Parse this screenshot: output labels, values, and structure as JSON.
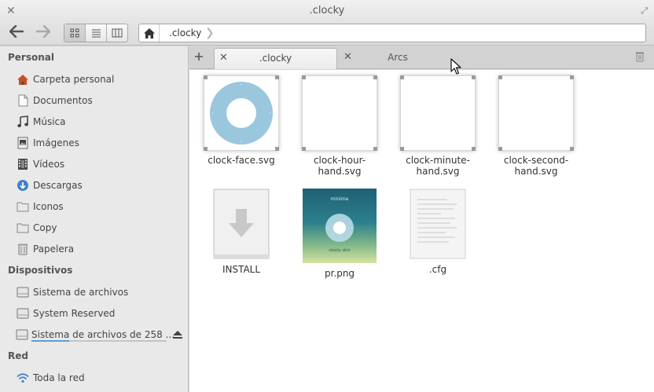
{
  "window": {
    "title": ".clocky"
  },
  "pathbar": {
    "crumb": ".clocky"
  },
  "sidebar": {
    "personal_title": "Personal",
    "personal": [
      {
        "label": "Carpeta personal",
        "icon": "home-icon"
      },
      {
        "label": "Documentos",
        "icon": "document-icon"
      },
      {
        "label": "Música",
        "icon": "music-icon"
      },
      {
        "label": "Imágenes",
        "icon": "image-icon"
      },
      {
        "label": "Vídeos",
        "icon": "video-icon"
      },
      {
        "label": "Descargas",
        "icon": "download-icon"
      },
      {
        "label": "Iconos",
        "icon": "folder-icon"
      },
      {
        "label": "Copy",
        "icon": "folder-icon"
      },
      {
        "label": "Papelera",
        "icon": "trash-icon"
      }
    ],
    "devices_title": "Dispositivos",
    "devices": [
      {
        "label": "Sistema de archivos",
        "icon": "drive-icon"
      },
      {
        "label": "System Reserved",
        "icon": "drive-icon"
      },
      {
        "label": "Sistema de archivos de 258 ...",
        "icon": "drive-icon",
        "usage_percent": 28
      }
    ],
    "network_title": "Red",
    "network": [
      {
        "label": "Toda la red",
        "icon": "network-icon"
      }
    ]
  },
  "tabs": [
    {
      "label": ".clocky",
      "active": true
    },
    {
      "label": "Arcs",
      "active": false
    }
  ],
  "files": [
    {
      "name": "clock-face.svg",
      "type": "svg-clockface"
    },
    {
      "name": "clock-hour-hand.svg",
      "type": "svg-blank"
    },
    {
      "name": "clock-minute-hand.svg",
      "type": "svg-blank"
    },
    {
      "name": "clock-second-hand.svg",
      "type": "svg-blank"
    },
    {
      "name": "INSTALL",
      "type": "install"
    },
    {
      "name": "pr.png",
      "type": "png-preview",
      "preview_text_top": "minima",
      "preview_text_bottom": "clocky skin"
    },
    {
      "name": ".cfg",
      "type": "text"
    }
  ],
  "colors": {
    "accent": "#5a9fd4",
    "clockface": "#9ac7de"
  }
}
